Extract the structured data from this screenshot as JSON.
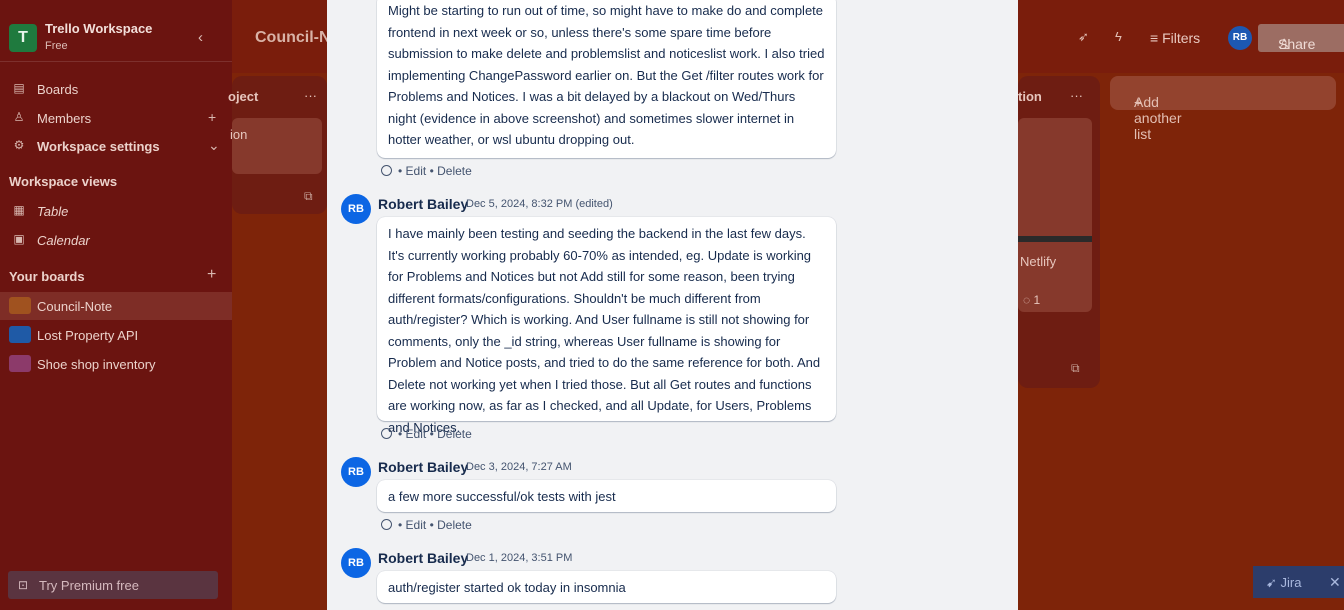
{
  "sidebar": {
    "workspace_logo": "T",
    "workspace_name": "Trello Workspace",
    "workspace_plan": "Free",
    "collapse_icon": "chevron-left-icon",
    "nav": [
      {
        "label": "Boards",
        "icon": "board-icon"
      },
      {
        "label": "Members",
        "icon": "member-icon"
      },
      {
        "label": "Workspace settings",
        "icon": "gear-icon"
      }
    ],
    "views_header": "Workspace views",
    "views": [
      {
        "label": "Table",
        "icon": "table-icon"
      },
      {
        "label": "Calendar",
        "icon": "calendar-icon"
      }
    ],
    "boards_header": "Your boards",
    "boards": [
      {
        "label": "Council-Note",
        "color": "#a0521f"
      },
      {
        "label": "Lost Property API",
        "color": "#1f5aa6"
      },
      {
        "label": "Shoe shop inventory",
        "color": "#8c3a6a"
      }
    ],
    "premium_label": "Try Premium free"
  },
  "topbar": {
    "board_title": "Council-N",
    "filters_label": "Filters",
    "avatar_initials": "RB",
    "share_label": "Share"
  },
  "board": {
    "list1_title": "oject",
    "list1_card_text": "ion",
    "list2_title": "tion",
    "list2_card_text": "Netlify",
    "list2_comment_count": "1",
    "add_list_label": "Add another list"
  },
  "jira_label": "Jira",
  "comments": [
    {
      "author": "",
      "date": "",
      "text": "Might be starting to run out of time, so might have to make do and complete frontend in next week or so, unless there's some spare time before submission to make delete and problemslist and noticeslist work. I also tried implementing ChangePassword earlier on. But the Get /filter routes work for Problems and Notices. I was a bit delayed by a blackout on Wed/Thurs night (evidence in above screenshot) and sometimes slower internet in hotter weather, or wsl ubuntu dropping out.",
      "edit": "Edit",
      "delete": "Delete"
    },
    {
      "initials": "RB",
      "author": "Robert Bailey",
      "date": "Dec 5, 2024, 8:32 PM (edited)",
      "text": "I have mainly been testing and seeding the backend in the last few days. It's currently working probably 60-70% as intended, eg. Update is working for Problems and Notices but not Add still for some reason, been trying different formats/configurations. Shouldn't be much different from auth/register? Which is working. And User fullname is still not showing for comments, only the _id string, whereas User fullname is showing for Problem and Notice posts, and tried to do the same reference for both. And Delete not working yet when I tried those. But all Get routes and functions are working now, as far as I checked, and all Update, for Users, Problems and Notices.",
      "edit": "Edit",
      "delete": "Delete"
    },
    {
      "initials": "RB",
      "author": "Robert Bailey",
      "date": "Dec 3, 2024, 7:27 AM",
      "text": "a few more successful/ok tests with jest",
      "edit": "Edit",
      "delete": "Delete"
    },
    {
      "initials": "RB",
      "author": "Robert Bailey",
      "date": "Dec 1, 2024, 3:51 PM",
      "text": "auth/register started ok today in insomnia"
    }
  ]
}
